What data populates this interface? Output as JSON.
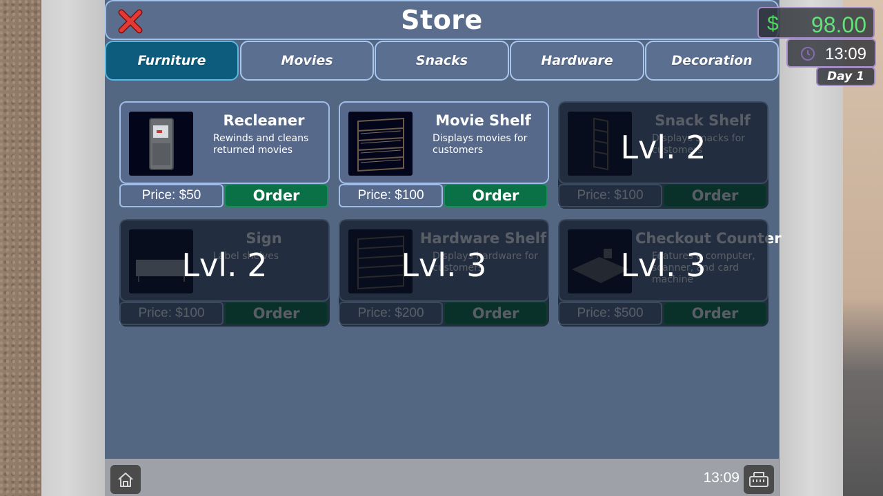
{
  "store": {
    "title": "Store",
    "tabs": [
      {
        "label": "Furniture",
        "active": true
      },
      {
        "label": "Movies",
        "active": false
      },
      {
        "label": "Snacks",
        "active": false
      },
      {
        "label": "Hardware",
        "active": false
      },
      {
        "label": "Decoration",
        "active": false
      }
    ],
    "items": [
      {
        "name": "Recleaner",
        "description": "Rewinds and cleans returned movies",
        "price": "Price: $50",
        "order_label": "Order",
        "locked": false,
        "lock_label": ""
      },
      {
        "name": "Movie Shelf",
        "description": "Displays movies for customers",
        "price": "Price: $100",
        "order_label": "Order",
        "locked": false,
        "lock_label": ""
      },
      {
        "name": "Snack Shelf",
        "description": "Displays snacks for customers",
        "price": "Price: $100",
        "order_label": "Order",
        "locked": true,
        "lock_label": "Lvl. 2"
      },
      {
        "name": "Sign",
        "description": "Label shelves",
        "price": "Price: $100",
        "order_label": "Order",
        "locked": true,
        "lock_label": "Lvl. 2"
      },
      {
        "name": "Hardware Shelf",
        "description": "Displays hardware for customers",
        "price": "Price: $200",
        "order_label": "Order",
        "locked": true,
        "lock_label": "Lvl. 3"
      },
      {
        "name": "Checkout Counter",
        "description": "Features a computer, scanner, and card machine",
        "price": "Price: $500",
        "order_label": "Order",
        "locked": true,
        "lock_label": "Lvl. 3"
      }
    ]
  },
  "bottom_bar": {
    "time": "13:09",
    "home_icon": "home-icon",
    "register_icon": "cash-register-icon"
  },
  "hud": {
    "currency_symbol": "$",
    "money": "98.00",
    "time": "13:09",
    "day": "Day 1",
    "money_color": "#63e27a"
  },
  "colors": {
    "panel": "#546782",
    "tab_active": "#0e5c7d",
    "order_button": "#0a7146",
    "close_icon": "#e53935"
  }
}
